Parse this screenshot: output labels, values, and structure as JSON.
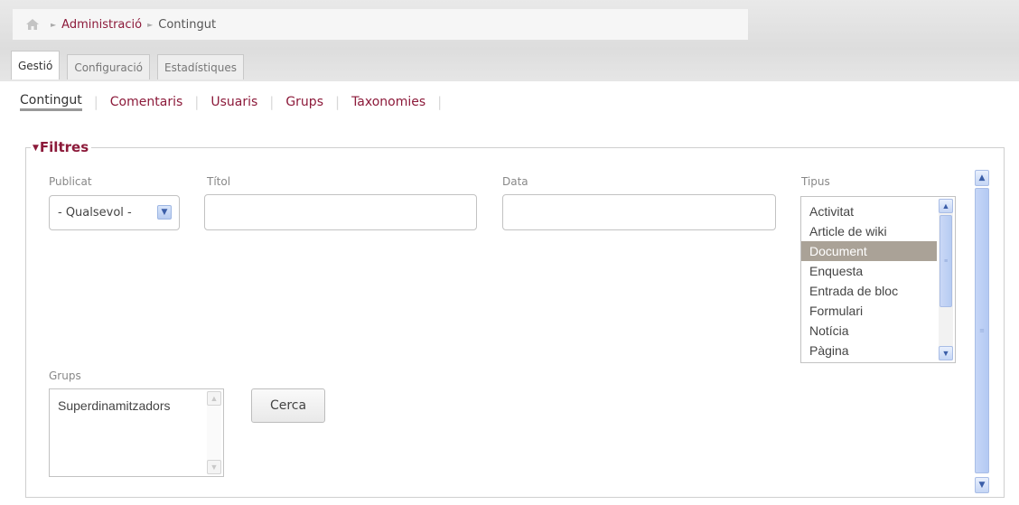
{
  "breadcrumb": {
    "home_icon": "home-icon",
    "items": [
      "Administració",
      "Contingut"
    ]
  },
  "tabs": [
    {
      "label": "Gestió",
      "active": true
    },
    {
      "label": "Configuració",
      "active": false
    },
    {
      "label": "Estadístiques",
      "active": false
    }
  ],
  "subnav": [
    {
      "label": "Contingut",
      "active": true
    },
    {
      "label": "Comentaris",
      "active": false
    },
    {
      "label": "Usuaris",
      "active": false
    },
    {
      "label": "Grups",
      "active": false
    },
    {
      "label": "Taxonomies",
      "active": false
    }
  ],
  "filters": {
    "legend": "Filtres",
    "publicat": {
      "label": "Publicat",
      "value": "- Qualsevol -"
    },
    "titol": {
      "label": "Títol",
      "value": ""
    },
    "data": {
      "label": "Data",
      "value": ""
    },
    "tipus": {
      "label": "Tipus",
      "options": [
        "Activitat",
        "Article de wiki",
        "Document",
        "Enquesta",
        "Entrada de bloc",
        "Formulari",
        "Notícia",
        "Pàgina"
      ],
      "selected": "Document"
    },
    "grups": {
      "label": "Grups",
      "options": [
        "Superdinamitzadors"
      ]
    },
    "search_button": "Cerca"
  },
  "colors": {
    "accent": "#8c1a3a",
    "selected_option": "#aaa297",
    "scrollbar": "#b6cbf2"
  }
}
